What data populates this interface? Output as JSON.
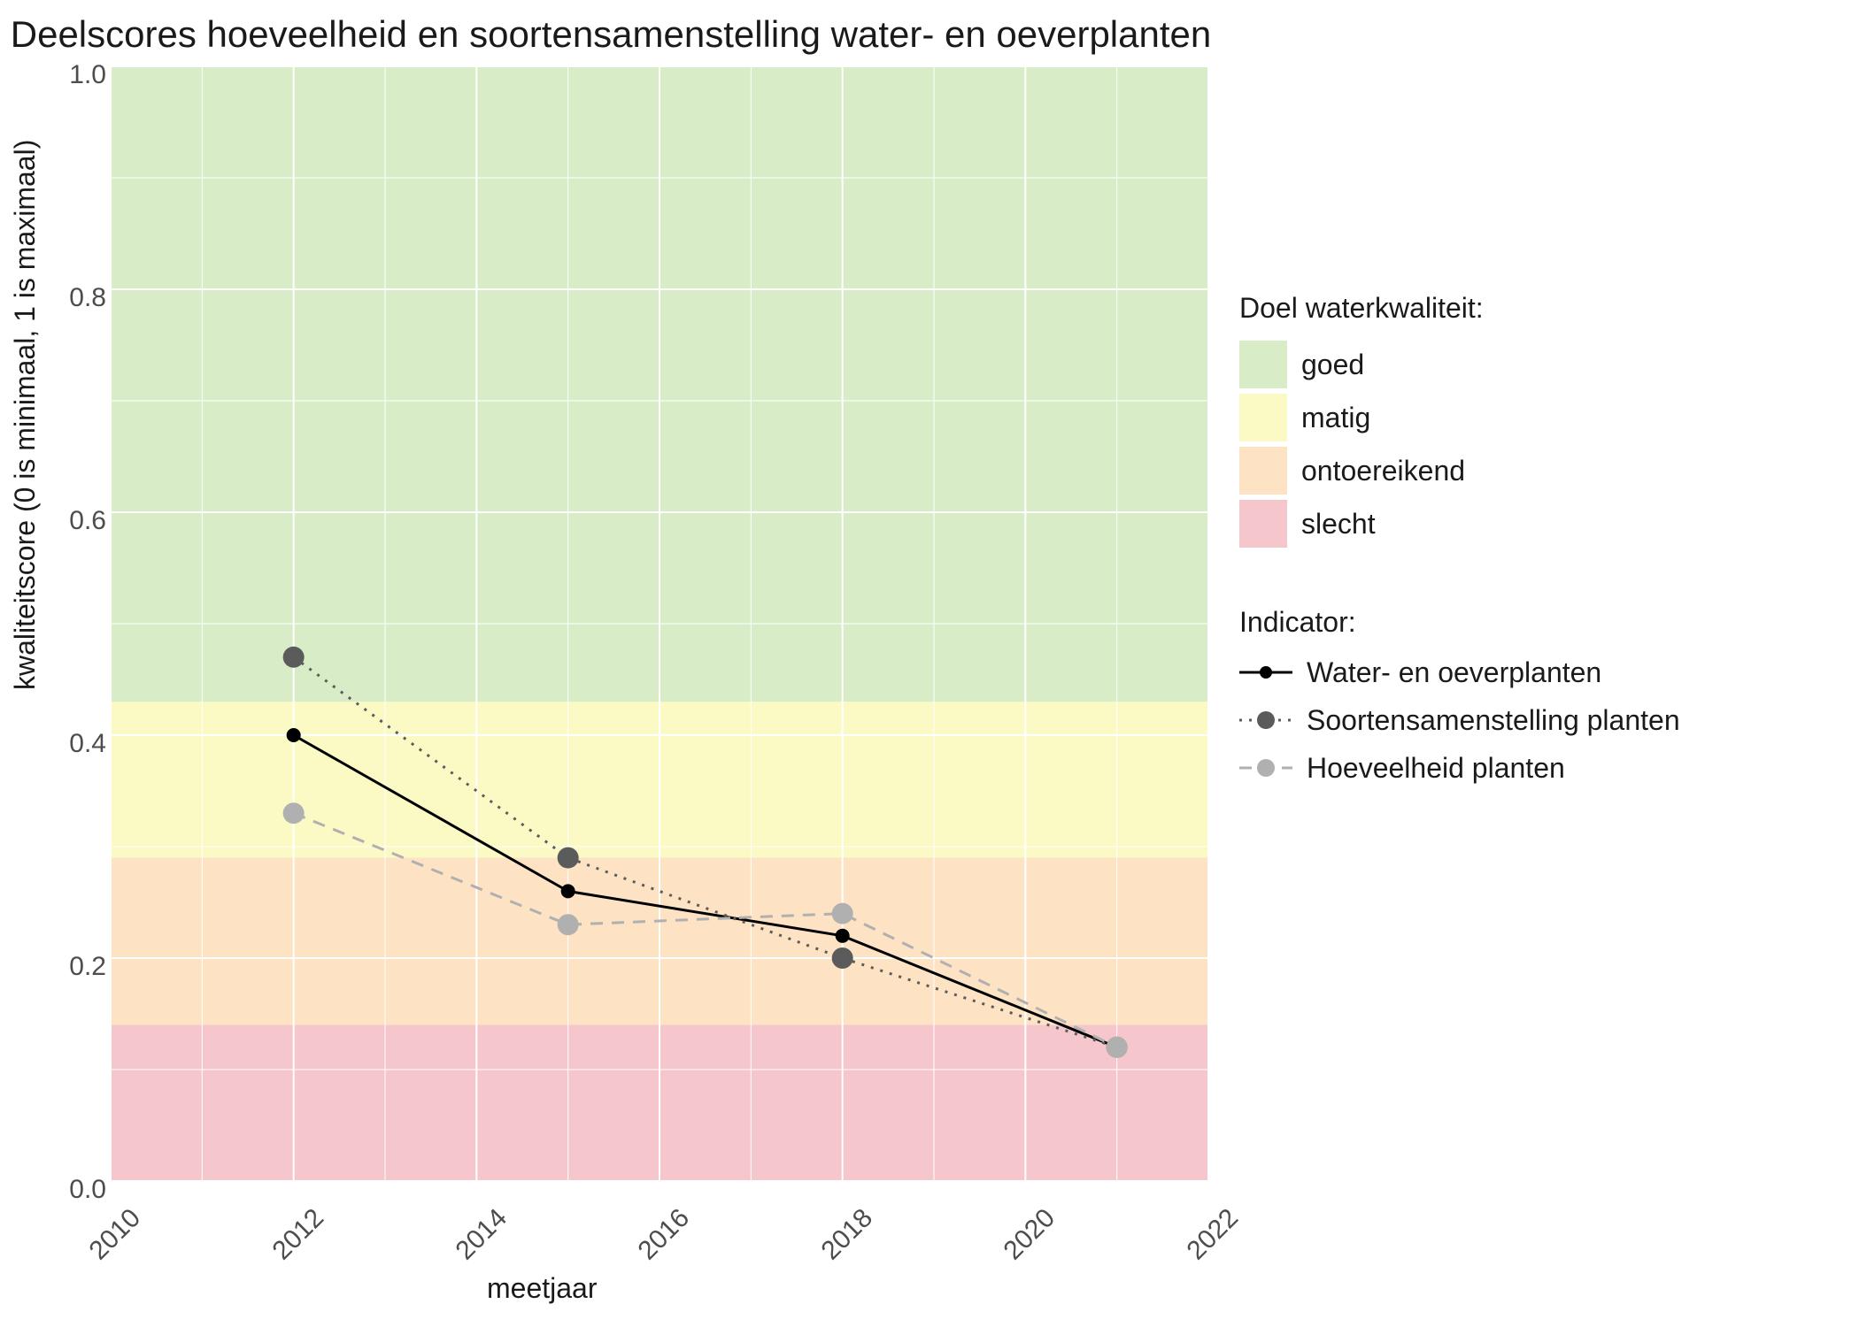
{
  "chart_data": {
    "type": "line",
    "title": "Deelscores hoeveelheid en soortensamenstelling water- en oeverplanten",
    "xlabel": "meetjaar",
    "ylabel": "kwaliteitscore (0 is minimaal, 1 is maximaal)",
    "xlim": [
      2010,
      2022
    ],
    "ylim": [
      0.0,
      1.0
    ],
    "x_ticks": [
      2010,
      2012,
      2014,
      2016,
      2018,
      2020,
      2022
    ],
    "y_ticks": [
      0.0,
      0.2,
      0.4,
      0.6,
      0.8,
      1.0
    ],
    "bands": [
      {
        "name": "goed",
        "ymin": 0.43,
        "ymax": 1.0,
        "color": "#d7ecc7"
      },
      {
        "name": "matig",
        "ymin": 0.29,
        "ymax": 0.43,
        "color": "#fbfac4"
      },
      {
        "name": "ontoereikend",
        "ymin": 0.14,
        "ymax": 0.29,
        "color": "#fde3c4"
      },
      {
        "name": "slecht",
        "ymin": 0.0,
        "ymax": 0.14,
        "color": "#f6c6cd"
      }
    ],
    "x": [
      2012,
      2015,
      2018,
      2021
    ],
    "series": [
      {
        "name": "Water- en oeverplanten",
        "values": [
          0.4,
          0.26,
          0.22,
          0.12
        ],
        "color": "#000000",
        "dash": "none",
        "marker_r": 8
      },
      {
        "name": "Soortensamenstelling planten",
        "values": [
          0.47,
          0.29,
          0.2,
          0.12
        ],
        "color": "#5b5b5b",
        "dash": "3,8",
        "marker_r": 12
      },
      {
        "name": "Hoeveelheid planten",
        "values": [
          0.33,
          0.23,
          0.24,
          0.12
        ],
        "color": "#b0b0b0",
        "dash": "14,10",
        "marker_r": 12
      }
    ],
    "legend1_title": "Doel waterkwaliteit:",
    "legend2_title": "Indicator:"
  },
  "y_tick_labels": {
    "0": "0.0",
    "1": "0.2",
    "2": "0.4",
    "3": "0.6",
    "4": "0.8",
    "5": "1.0"
  },
  "x_tick_labels": {
    "0": "2010",
    "1": "2012",
    "2": "2014",
    "3": "2016",
    "4": "2018",
    "5": "2020",
    "6": "2022"
  }
}
